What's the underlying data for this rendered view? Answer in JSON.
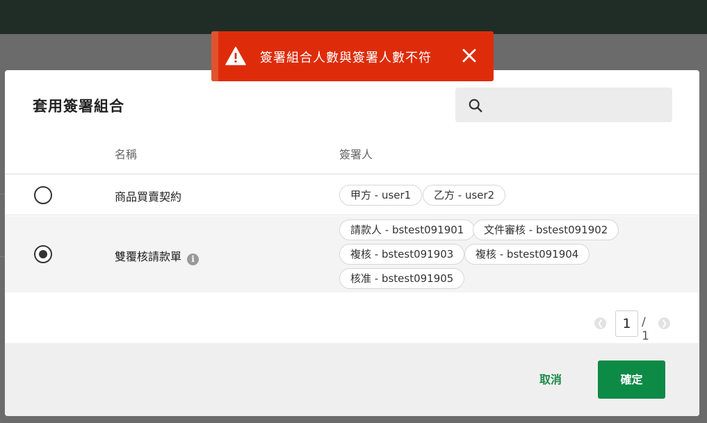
{
  "toast": {
    "message": "簽署組合人數與簽署人數不符",
    "icons": {
      "warning": "warning-triangle-icon",
      "close": "close-icon"
    }
  },
  "modal": {
    "title": "套用簽署組合",
    "search": {
      "value": "",
      "placeholder": ""
    },
    "columns": {
      "name": "名稱",
      "signers": "簽署人"
    },
    "rows": [
      {
        "name": "商品買賣契約",
        "selected": false,
        "signers": [
          "甲方 - user1",
          "乙方 - user2"
        ]
      },
      {
        "name": "雙覆核請款單",
        "selected": true,
        "info_icon": "info-icon",
        "signers": [
          "請款人 - bstest091901",
          "文件審核 - bstest091902",
          "複核 - bstest091903",
          "複核 - bstest091904",
          "核准 - bstest091905"
        ]
      }
    ],
    "pagination": {
      "current": "1",
      "total": "/ 1"
    },
    "buttons": {
      "cancel": "取消",
      "confirm": "確定"
    }
  },
  "colors": {
    "toast_bg": "#de2c0a",
    "primary": "#0c8a46",
    "topbar": "#1f2d26"
  }
}
